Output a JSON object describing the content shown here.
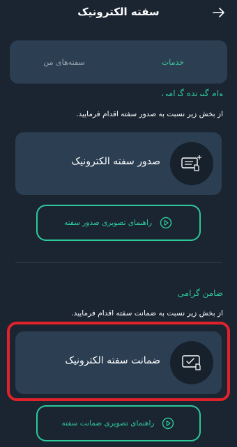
{
  "header": {
    "title": "سفته الکترونیک",
    "back_icon": "arrow-right-icon"
  },
  "tabs": [
    {
      "label": "خدمات",
      "active": true
    },
    {
      "label": "سفته‌های من",
      "active": false
    }
  ],
  "issuer_section": {
    "label": "وام گیرنده گرامی",
    "description": "از بخش زیر نسبت به صدور سفته اقدام فرمایید.",
    "card_label": "صدور سفته الکترونیک",
    "card_icon": "issue-document-icon",
    "guide_label": "راهنمای تصویری صدور سفته",
    "guide_icon": "play-icon"
  },
  "guarantor_section": {
    "label": "ضامن گرامی",
    "description": "از بخش زیر نسبت به ضمانت سفته اقدام فرمایید.",
    "card_label": "ضمانت سفته الکترونیک",
    "card_icon": "guarantee-document-icon",
    "guide_label": "راهنمای تصویری ضمانت سفته",
    "guide_icon": "play-icon"
  },
  "colors": {
    "background": "#1b2532",
    "card": "#2b3e52",
    "accent": "#2ec99a",
    "highlight": "#e1222a"
  }
}
